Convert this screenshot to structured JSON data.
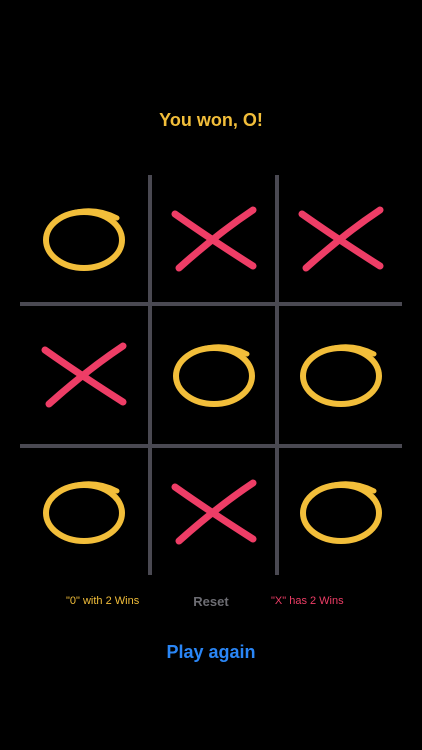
{
  "status_message": "You won, O!",
  "board": {
    "cells": [
      "O",
      "X",
      "X",
      "X",
      "O",
      "O",
      "O",
      "X",
      "O"
    ]
  },
  "scores": {
    "o_text": "\"0\" with 2 Wins",
    "reset_label": "Reset",
    "x_text": "\"X\" has 2 Wins"
  },
  "play_again_label": "Play again",
  "colors": {
    "background": "#000000",
    "o_mark": "#f2be3a",
    "x_mark": "#ee3d66",
    "grid": "#4a4952",
    "reset": "#6d6d73",
    "play_again": "#2a86f6"
  }
}
